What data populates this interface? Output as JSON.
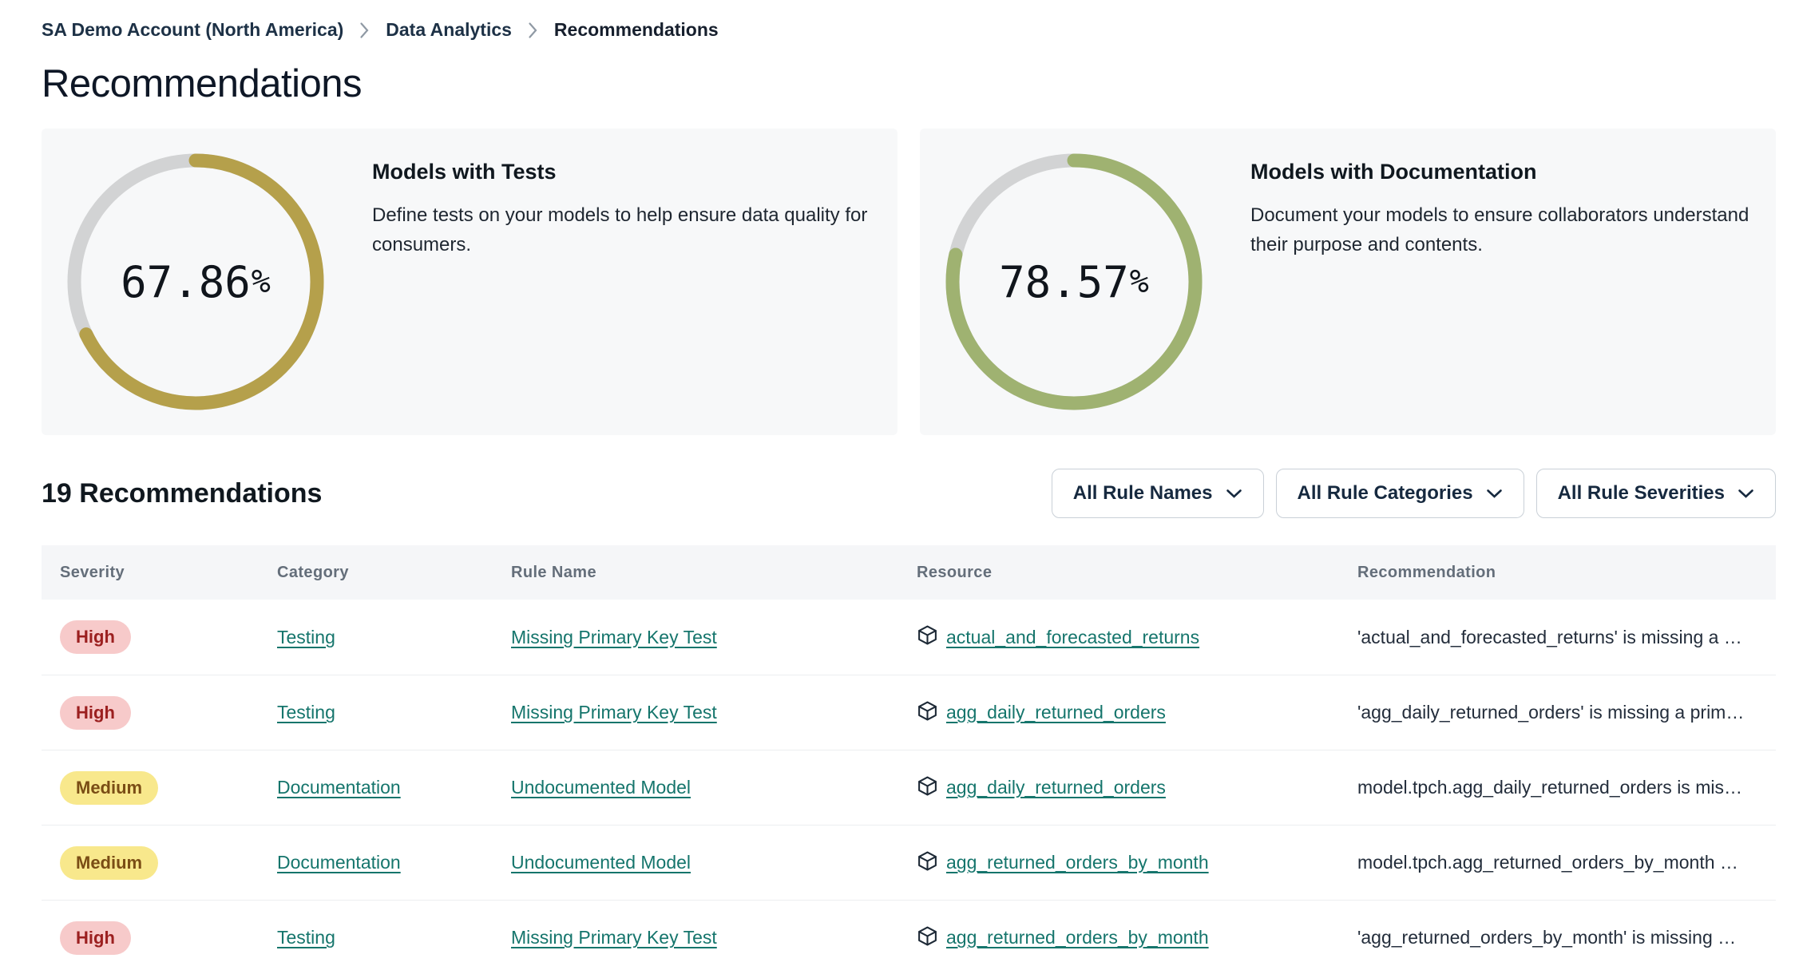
{
  "breadcrumb": {
    "items": [
      "SA Demo Account (North America)",
      "Data Analytics",
      "Recommendations"
    ]
  },
  "page": {
    "title": "Recommendations"
  },
  "cards": [
    {
      "title": "Models with Tests",
      "description": "Define tests on your models to help ensure data quality for consumers.",
      "percent": "67.86",
      "percent_sign": "%",
      "value": 67.86,
      "ring_color": "#b5a04b"
    },
    {
      "title": "Models with Documentation",
      "description": "Document your models to ensure collaborators understand their purpose and contents.",
      "percent": "78.57",
      "percent_sign": "%",
      "value": 78.57,
      "ring_color": "#9fb271"
    }
  ],
  "list_header": {
    "count_label": "19 Recommendations",
    "filters": [
      {
        "label": "All Rule Names"
      },
      {
        "label": "All Rule Categories"
      },
      {
        "label": "All Rule Severities"
      }
    ]
  },
  "table": {
    "columns": [
      "Severity",
      "Category",
      "Rule Name",
      "Resource",
      "Recommendation"
    ],
    "rows": [
      {
        "severity": "High",
        "severity_level": "high",
        "category": "Testing",
        "rule_name": "Missing Primary Key Test",
        "resource": "actual_and_forecasted_returns",
        "recommendation": "'actual_and_forecasted_returns' is missing a …"
      },
      {
        "severity": "High",
        "severity_level": "high",
        "category": "Testing",
        "rule_name": "Missing Primary Key Test",
        "resource": "agg_daily_returned_orders",
        "recommendation": "'agg_daily_returned_orders' is missing a prim…"
      },
      {
        "severity": "Medium",
        "severity_level": "medium",
        "category": "Documentation",
        "rule_name": "Undocumented Model",
        "resource": "agg_daily_returned_orders",
        "recommendation": "model.tpch.agg_daily_returned_orders is mis…"
      },
      {
        "severity": "Medium",
        "severity_level": "medium",
        "category": "Documentation",
        "rule_name": "Undocumented Model",
        "resource": "agg_returned_orders_by_month",
        "recommendation": "model.tpch.agg_returned_orders_by_month …"
      },
      {
        "severity": "High",
        "severity_level": "high",
        "category": "Testing",
        "rule_name": "Missing Primary Key Test",
        "resource": "agg_returned_orders_by_month",
        "recommendation": "'agg_returned_orders_by_month' is missing …"
      }
    ]
  },
  "icons": {
    "breadcrumb_separator": "chevron-right-icon",
    "filter_dropdown": "chevron-down-icon",
    "resource": "cube-icon"
  },
  "colors": {
    "link_teal": "#15756c",
    "ring_track": "#d2d3d4",
    "ring_tests": "#b5a04b",
    "ring_docs": "#9fb271",
    "badge_high_bg": "#f7caca",
    "badge_high_text": "#9b1f1f",
    "badge_medium_bg": "#f8e88c",
    "badge_medium_text": "#7a4d15",
    "card_bg": "#f7f8f9",
    "table_header_bg": "#f5f6f8"
  }
}
